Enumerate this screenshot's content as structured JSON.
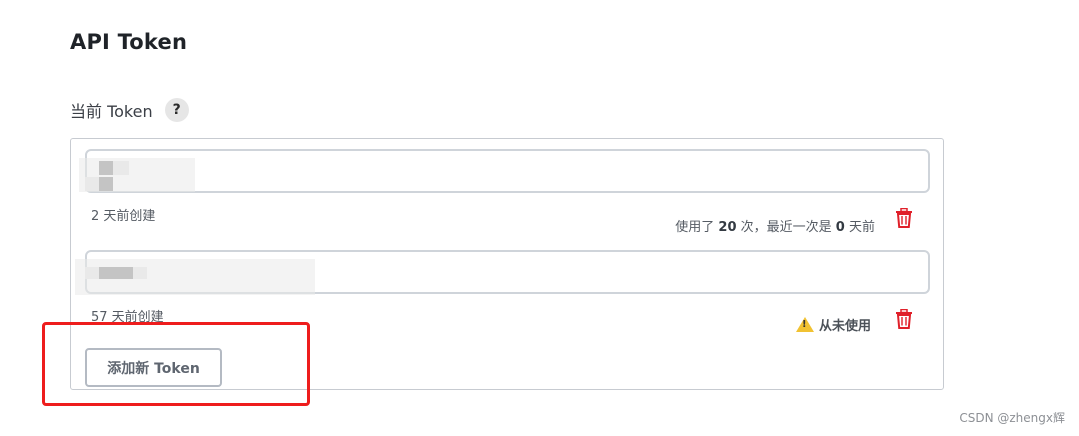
{
  "section": {
    "title": "API Token",
    "current_label": "当前 Token",
    "help_icon_text": "?"
  },
  "tokens": [
    {
      "value": "",
      "created": "2 天前创建",
      "usage_prefix": "使用了",
      "usage_count": "20",
      "usage_mid": "次，最近一次是",
      "usage_days": "0",
      "usage_suffix": "天前"
    },
    {
      "value": "",
      "created": "57 天前创建",
      "warning": "从未使用"
    }
  ],
  "actions": {
    "add_token": "添加新 Token"
  },
  "watermark": "CSDN @zhengx辉",
  "colors": {
    "highlight": "#ee1d1d",
    "trash": "#e0202a",
    "warning": "#f1c232"
  }
}
